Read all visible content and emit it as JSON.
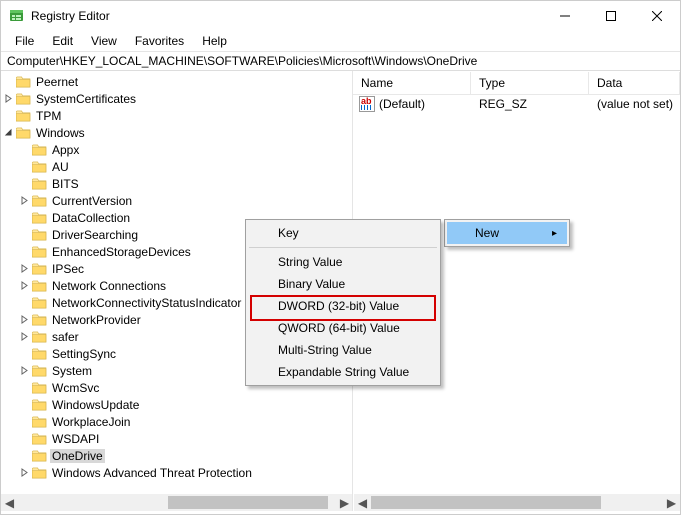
{
  "window": {
    "title": "Registry Editor"
  },
  "menu": {
    "file": "File",
    "edit": "Edit",
    "view": "View",
    "favorites": "Favorites",
    "help": "Help"
  },
  "address": "Computer\\HKEY_LOCAL_MACHINE\\SOFTWARE\\Policies\\Microsoft\\Windows\\OneDrive",
  "tree": [
    {
      "indent": 6,
      "expand": "",
      "label": "Peernet"
    },
    {
      "indent": 6,
      "expand": ">",
      "label": "SystemCertificates"
    },
    {
      "indent": 6,
      "expand": "",
      "label": "TPM"
    },
    {
      "indent": 6,
      "expand": "v",
      "label": "Windows"
    },
    {
      "indent": 7,
      "expand": "",
      "label": "Appx"
    },
    {
      "indent": 7,
      "expand": "",
      "label": "AU"
    },
    {
      "indent": 7,
      "expand": "",
      "label": "BITS"
    },
    {
      "indent": 7,
      "expand": ">",
      "label": "CurrentVersion"
    },
    {
      "indent": 7,
      "expand": "",
      "label": "DataCollection"
    },
    {
      "indent": 7,
      "expand": "",
      "label": "DriverSearching"
    },
    {
      "indent": 7,
      "expand": "",
      "label": "EnhancedStorageDevices"
    },
    {
      "indent": 7,
      "expand": ">",
      "label": "IPSec"
    },
    {
      "indent": 7,
      "expand": ">",
      "label": "Network Connections"
    },
    {
      "indent": 7,
      "expand": "",
      "label": "NetworkConnectivityStatusIndicator"
    },
    {
      "indent": 7,
      "expand": ">",
      "label": "NetworkProvider"
    },
    {
      "indent": 7,
      "expand": ">",
      "label": "safer"
    },
    {
      "indent": 7,
      "expand": "",
      "label": "SettingSync"
    },
    {
      "indent": 7,
      "expand": ">",
      "label": "System"
    },
    {
      "indent": 7,
      "expand": "",
      "label": "WcmSvc"
    },
    {
      "indent": 7,
      "expand": "",
      "label": "WindowsUpdate"
    },
    {
      "indent": 7,
      "expand": "",
      "label": "WorkplaceJoin"
    },
    {
      "indent": 7,
      "expand": "",
      "label": "WSDAPI"
    },
    {
      "indent": 7,
      "expand": "",
      "label": "OneDrive",
      "selected": true
    },
    {
      "indent": 7,
      "expand": ">",
      "label": "Windows Advanced Threat Protection"
    }
  ],
  "columns": {
    "name": "Name",
    "type": "Type",
    "data": "Data"
  },
  "values": [
    {
      "name": "(Default)",
      "type": "REG_SZ",
      "data": "(value not set)"
    }
  ],
  "ctxmain": {
    "new": "New"
  },
  "ctxsub": {
    "key": "Key",
    "string": "String Value",
    "binary": "Binary Value",
    "dword": "DWORD (32-bit) Value",
    "qword": "QWORD (64-bit) Value",
    "multi": "Multi-String Value",
    "expand": "Expandable String Value"
  }
}
